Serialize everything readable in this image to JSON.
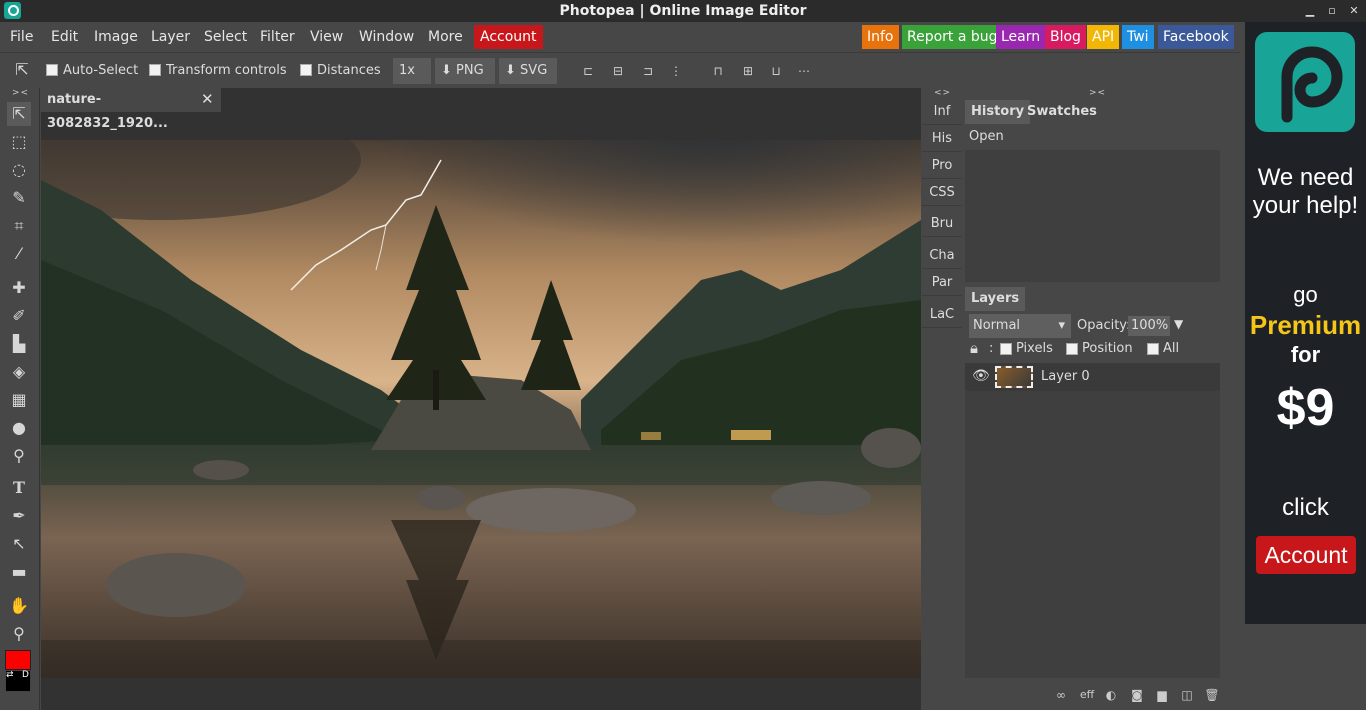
{
  "window": {
    "title": "Photopea | Online Image Editor"
  },
  "menu": {
    "items": [
      "File",
      "Edit",
      "Image",
      "Layer",
      "Select",
      "Filter",
      "View",
      "Window",
      "More"
    ],
    "account": "Account",
    "links": [
      {
        "label": "Info",
        "color": "#e8720c"
      },
      {
        "label": "Report a bug",
        "color": "#39a33a"
      },
      {
        "label": "Learn",
        "color": "#9a27b0"
      },
      {
        "label": "Blog",
        "color": "#d81b60"
      },
      {
        "label": "API",
        "color": "#f2b705"
      },
      {
        "label": "Twi",
        "color": "#1e8fe1"
      },
      {
        "label": "Facebook",
        "color": "#3b5998"
      }
    ]
  },
  "options": {
    "auto_select": "Auto-Select",
    "transform_controls": "Transform controls",
    "distances": "Distances",
    "zoom": "1x",
    "png": "PNG",
    "svg": "SVG"
  },
  "document": {
    "tab_title": "nature-3082832_1920..."
  },
  "side_tabs": [
    "Inf",
    "His",
    "Pro",
    "CSS",
    "Bru",
    "Cha",
    "Par",
    "LaC"
  ],
  "history": {
    "tabs": [
      "History",
      "Swatches"
    ],
    "items": [
      "Open"
    ]
  },
  "layers": {
    "tab": "Layers",
    "blend_mode": "Normal",
    "opacity_label": "Opacity:",
    "opacity": "100%",
    "lock_label": ":",
    "lock_options": [
      "Pixels",
      "Position",
      "All"
    ],
    "items": [
      {
        "name": "Layer 0"
      }
    ]
  },
  "ad": {
    "line1": "We need",
    "line2": "your help!",
    "go": "go",
    "premium": "Premium",
    "for": "for",
    "price": "$9",
    "click": "click",
    "account": "Account"
  },
  "colors": {
    "foreground": "#ff0000",
    "background": "#000000"
  }
}
